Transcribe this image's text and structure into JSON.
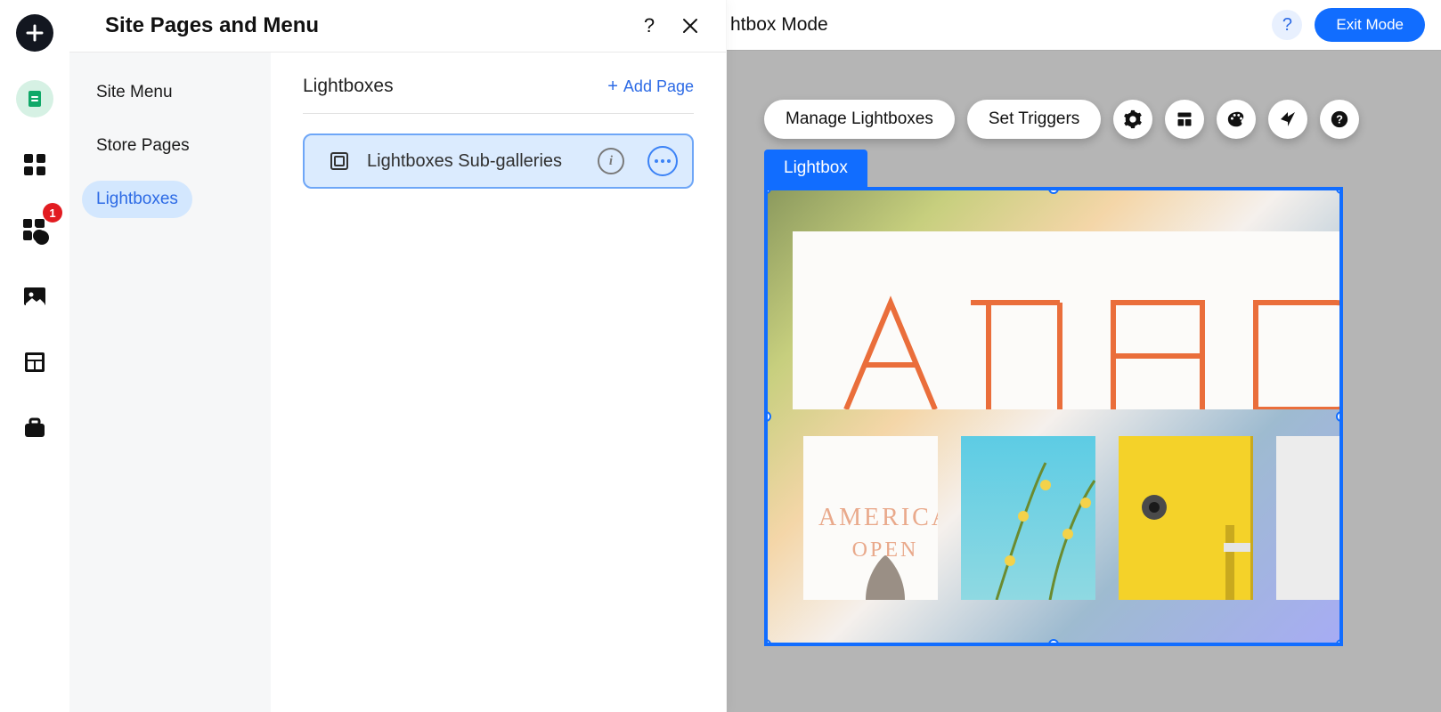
{
  "rail": {
    "apps_badge": "1"
  },
  "panel": {
    "title": "Site Pages and Menu",
    "nav": [
      {
        "label": "Site Menu"
      },
      {
        "label": "Store Pages"
      },
      {
        "label": "Lightboxes"
      }
    ],
    "active_nav_index": 2,
    "section_title": "Lightboxes",
    "add_page_label": "Add Page",
    "items": [
      {
        "label": "Lightboxes Sub-galleries"
      }
    ]
  },
  "canvas": {
    "mode_label": "htbox Mode",
    "exit_label": "Exit Mode",
    "toolbar": {
      "manage": "Manage Lightboxes",
      "triggers": "Set Triggers"
    },
    "selection_tab": "Lightbox"
  }
}
